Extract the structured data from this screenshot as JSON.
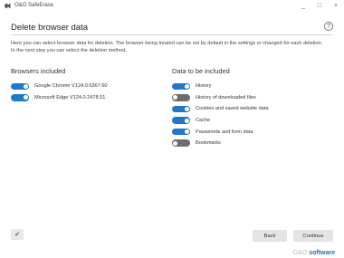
{
  "window": {
    "title": "O&O SafeErase",
    "controls": [
      "_",
      "□",
      "×"
    ]
  },
  "page": {
    "title": "Delete browser data",
    "help_icon": "?",
    "description": "Here you can select browser data for deletion. The browser being treated can be set by default in the settings or changed for each deletion. In the next step you can select the deletion method."
  },
  "browsers": {
    "heading": "Browsers included",
    "items": [
      {
        "label": "Google Chrome V124.0.6367.60",
        "enabled": true
      },
      {
        "label": "Microsoft Edge V124.0.2478.51",
        "enabled": true
      }
    ]
  },
  "data_types": {
    "heading": "Data to be included",
    "items": [
      {
        "label": "History",
        "enabled": true
      },
      {
        "label": "History of downloaded files",
        "enabled": false
      },
      {
        "label": "Cookies and saved website data",
        "enabled": true
      },
      {
        "label": "Cache",
        "enabled": true
      },
      {
        "label": "Passwords and form data",
        "enabled": true
      },
      {
        "label": "Bookmarks",
        "enabled": false
      }
    ]
  },
  "footer": {
    "check_icon": "✔",
    "back_label": "Back",
    "continue_label": "Continue",
    "brand_prefix": "O&O",
    "brand_name": "software"
  },
  "colors": {
    "toggle_on": "#1f78c8",
    "toggle_off": "#6d6d6d",
    "brand": "#2a6fb5"
  }
}
